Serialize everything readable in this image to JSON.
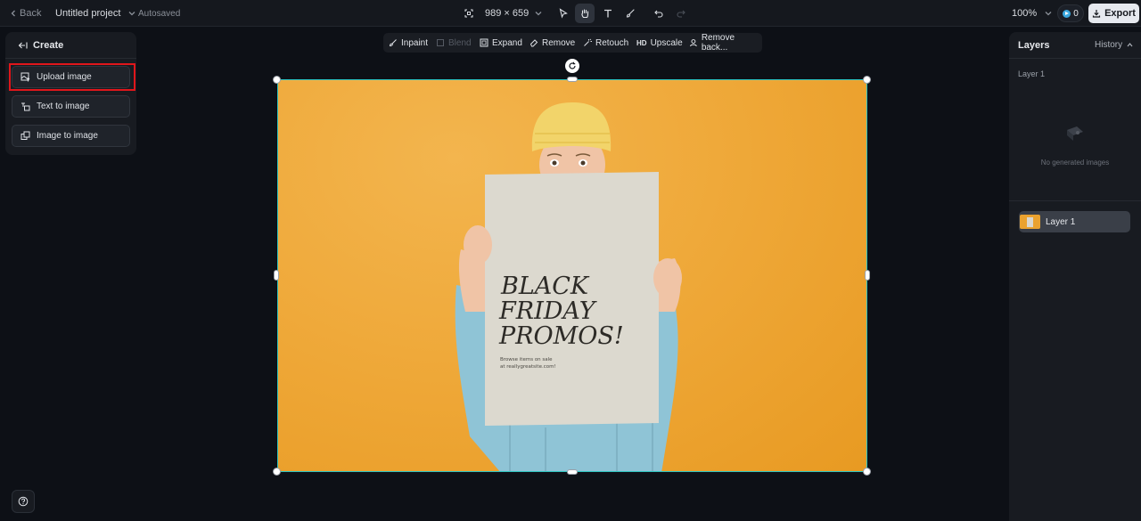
{
  "topbar": {
    "back_label": "Back",
    "project_title": "Untitled project",
    "save_status": "Autosaved",
    "canvas_size": "989 × 659",
    "zoom": "100%",
    "credits": "0",
    "export_label": "Export"
  },
  "left_panel": {
    "header_label": "Create",
    "buttons": [
      {
        "label": "Upload image"
      },
      {
        "label": "Text to image"
      },
      {
        "label": "Image to image"
      }
    ]
  },
  "canvas_toolbar": {
    "inpaint": "Inpaint",
    "blend": "Blend",
    "expand": "Expand",
    "remove": "Remove",
    "retouch": "Retouch",
    "upscale": "Upscale",
    "upscale_badge": "HD",
    "remove_background": "Remove back..."
  },
  "poster": {
    "line1": "BLACK",
    "line2": "FRIDAY",
    "line3": "PROMOS!",
    "small1": "Browse items on sale",
    "small2": "at reallygreatsite.com!"
  },
  "right_panel": {
    "tab_layers": "Layers",
    "tab_history": "History",
    "section_label": "Layer 1",
    "empty_text": "No generated images",
    "layer_item_label": "Layer 1"
  },
  "colors": {
    "accent_selection": "#2ec4c0",
    "highlight_box": "#e0161b",
    "image_background": "#efa93a"
  }
}
